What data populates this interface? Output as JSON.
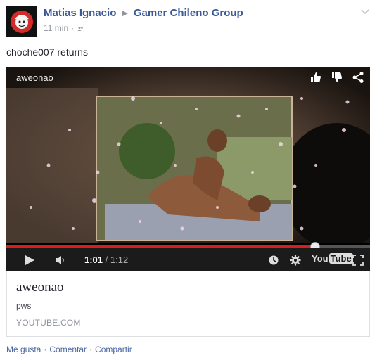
{
  "post": {
    "author": "Matias Ignacio",
    "group": "Gamer Chileno Group",
    "time": "11 min",
    "separator": "·",
    "text": "choche007 returns"
  },
  "video": {
    "title": "aweonao",
    "current_time": "1:01",
    "total_time": "/ 1:12",
    "progress": 0.847,
    "logo_you": "You",
    "logo_tube": "Tube"
  },
  "card": {
    "title": "aweonao",
    "description": "pws",
    "domain": "YOUTUBE.COM"
  },
  "actions": {
    "like": "Me gusta",
    "comment": "Comentar",
    "share": "Compartir",
    "sep": "·"
  },
  "colors": {
    "link": "#3b5998",
    "progress": "#d71e1e"
  }
}
